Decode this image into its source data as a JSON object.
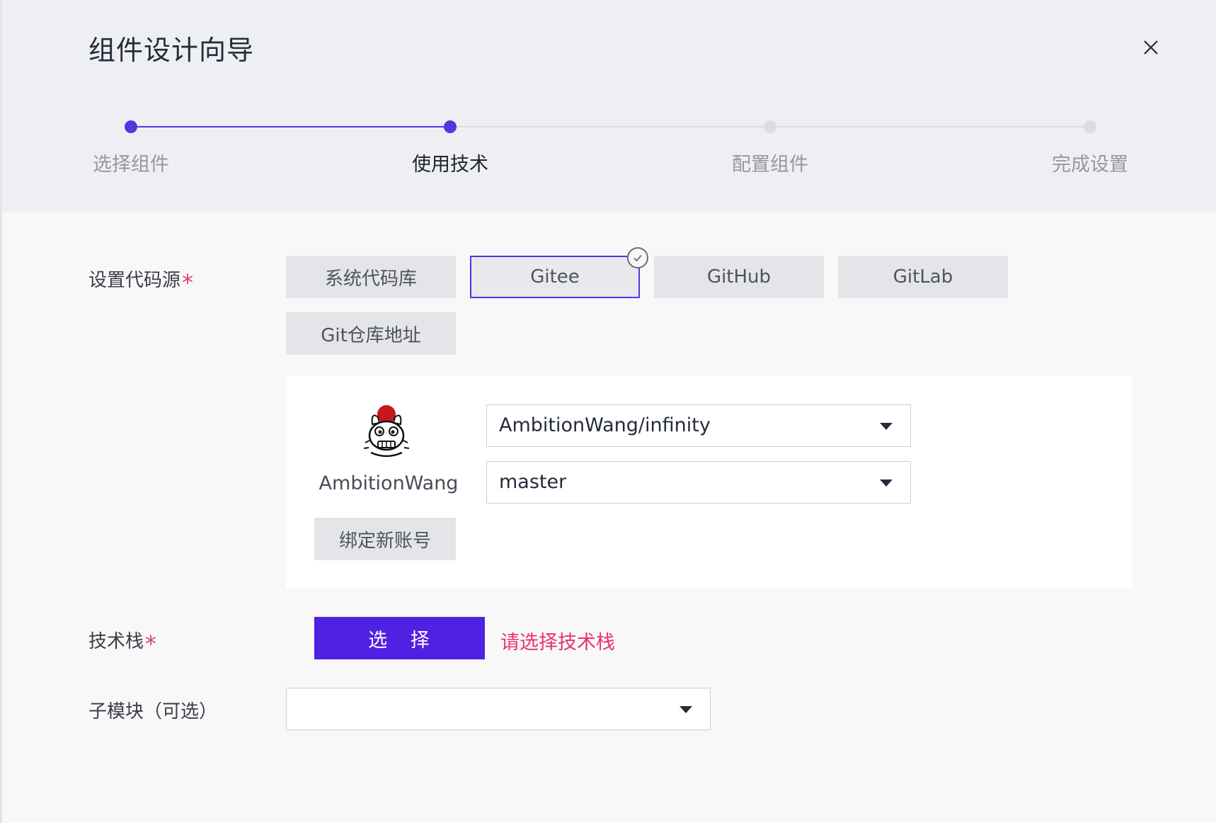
{
  "dialog": {
    "title": "组件设计向导",
    "close_icon": "close-icon"
  },
  "stepper": {
    "steps": [
      {
        "label": "选择组件",
        "state": "done"
      },
      {
        "label": "使用技术",
        "state": "active"
      },
      {
        "label": "配置组件",
        "state": "pending"
      },
      {
        "label": "完成设置",
        "state": "pending"
      }
    ],
    "colors": {
      "done": "#5236e0",
      "pending": "#dcdde2",
      "label_active": "#1f2230",
      "label_pending": "#9597a3"
    }
  },
  "code_source": {
    "label": "设置代码源",
    "required_mark": "*",
    "options": [
      {
        "label": "系统代码库",
        "selected": false
      },
      {
        "label": "Gitee",
        "selected": true
      },
      {
        "label": "GitHub",
        "selected": false
      },
      {
        "label": "GitLab",
        "selected": false
      },
      {
        "label": "Git仓库地址",
        "selected": false
      }
    ]
  },
  "account": {
    "name": "AmbitionWang",
    "avatar_icon": "avatar",
    "bind_button": "绑定新账号",
    "repo_select": {
      "value": "AmbitionWang/infinity"
    },
    "branch_select": {
      "value": "master"
    }
  },
  "tech_stack": {
    "label": "技术栈",
    "required_mark": "*",
    "button": "选 择",
    "error": "请选择技术栈"
  },
  "submodule": {
    "label": "子模块（可选）",
    "value": ""
  },
  "colors": {
    "primary": "#5020e3",
    "error": "#e8336c",
    "header_bg": "#eeeff2",
    "body_bg": "#f8f8f9"
  }
}
